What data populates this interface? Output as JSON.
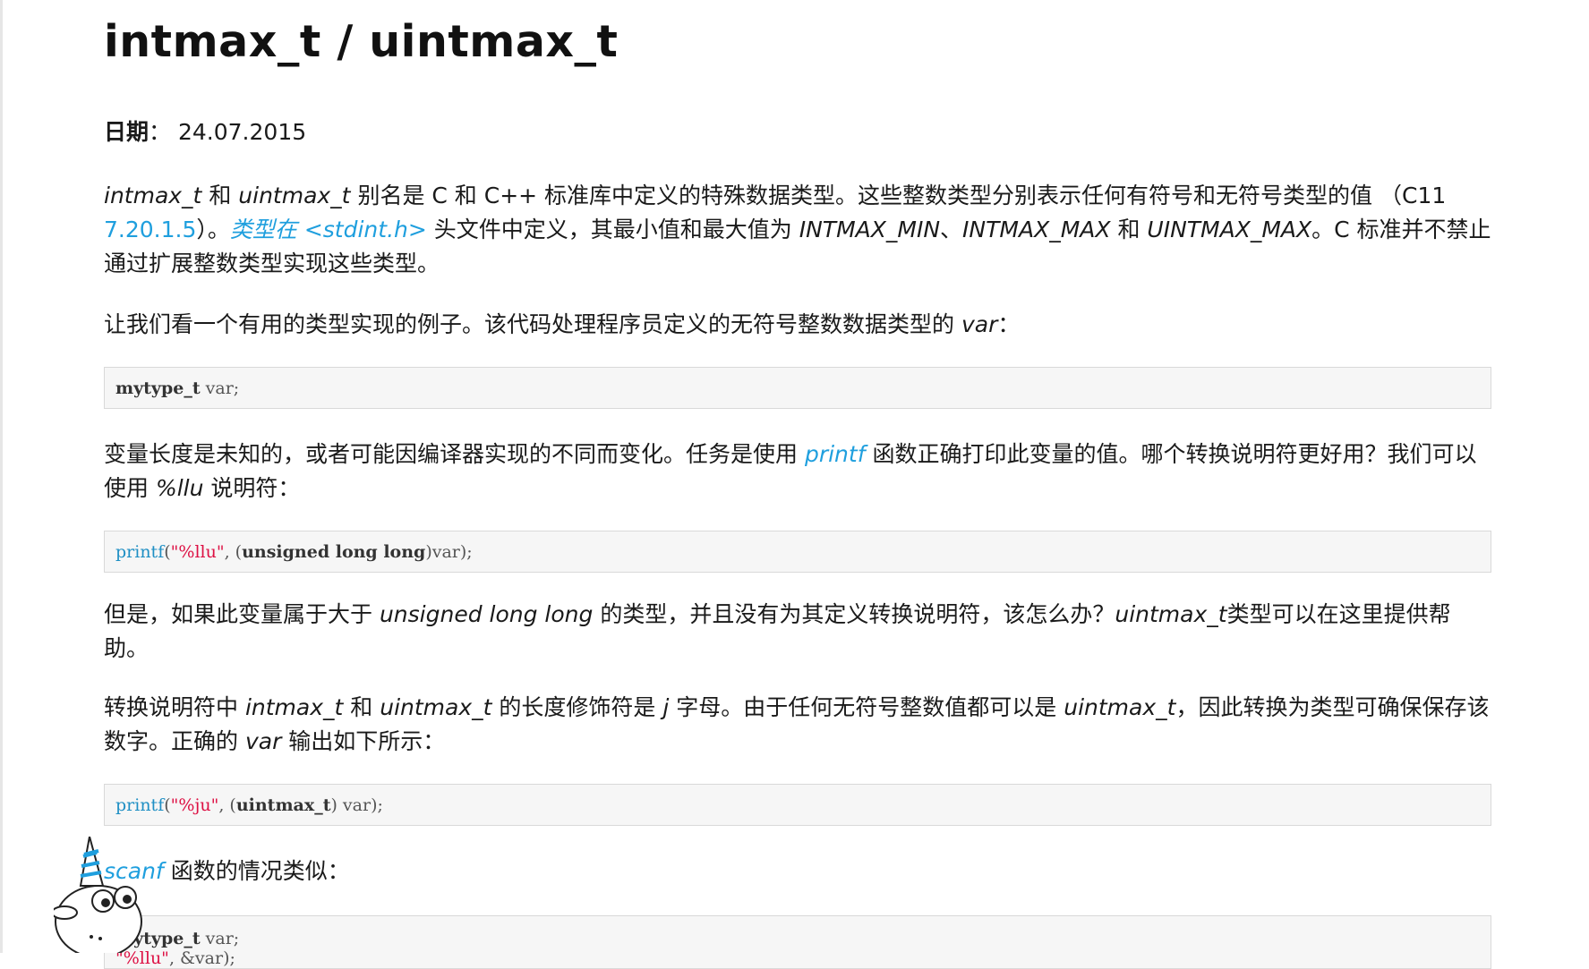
{
  "title": "intmax_t / uintmax_t",
  "date": {
    "label": "日期",
    "sep": "：",
    "value": "24.07.2015"
  },
  "p1": {
    "t1": "intmax_t",
    "t2": " 和 ",
    "t3": "uintmax_t",
    "t4": " 别名是 C 和 C++ 标准库中定义的特殊数据类型。这些整数类型分别表示任何有符号和无符号类型的值 （C11 ",
    "link1": "7.20.1.5",
    "t5": "）。",
    "link2": "类型在 <stdint.h>",
    "t6": " 头文件中定义，其最小值和最大值为 ",
    "t7": "INTMAX_MIN",
    "t8": "、",
    "t9": "INTMAX_MAX",
    "t10": " 和 ",
    "t11": "UINTMAX_MAX",
    "t12": "。C 标准并不禁止通过扩展整数类型实现这些类型。"
  },
  "p2": {
    "t1": "让我们看一个有用的类型实现的例子。该代码处理程序员定义的无符号整数数据类型的 ",
    "t2": "var",
    "t3": "："
  },
  "code1": {
    "kw": "mytype_t",
    "rest": " var;"
  },
  "p3": {
    "t1": "变量长度是未知的，或者可能因编译器实现的不同而变化。任务是使用 ",
    "link": "printf",
    "t2": " 函数正确打印此变量的值。哪个转换说明符更好用？我们可以使用 ",
    "t3": "%llu",
    "t4": " 说明符："
  },
  "code2": {
    "fn": "printf",
    "p1": "(",
    "str": "\"%llu\"",
    "p2": ", (",
    "kw": "unsigned long long",
    "p3": ")var);"
  },
  "p4": {
    "t1": "但是，如果此变量属于大于 ",
    "t2": "unsigned long long",
    "t3": " 的类型，并且没有为其定义转换说明符，该怎么办？",
    "t4": "uintmax_t",
    "t5": "类型可以在这里提供帮助。"
  },
  "p5": {
    "t1": "转换说明符中 ",
    "t2": "intmax_t",
    "t3": " 和 ",
    "t4": "uintmax_t",
    "t5": " 的长度修饰符是 ",
    "t6": "j",
    "t7": " 字母。由于任何无符号整数值都可以是 ",
    "t8": "uintmax_t",
    "t9": "，因此转换为类型可确保保存该数字。正确的 ",
    "t10": "var",
    "t11": " 输出如下所示："
  },
  "code3": {
    "fn": "printf",
    "p1": "(",
    "str": "\"%ju\"",
    "p2": ", (",
    "kw": "uintmax_t",
    "p3": ") var);"
  },
  "p6": {
    "link": "scanf",
    "t1": " 函数的情况类似："
  },
  "code4": {
    "line1_kw": "mytype_t",
    "line1_rest": " var;",
    "line2_str": "\"%llu\"",
    "line2_rest": ", &var);"
  },
  "mascot": {
    "icon": "unicorn-mascot-icon"
  }
}
